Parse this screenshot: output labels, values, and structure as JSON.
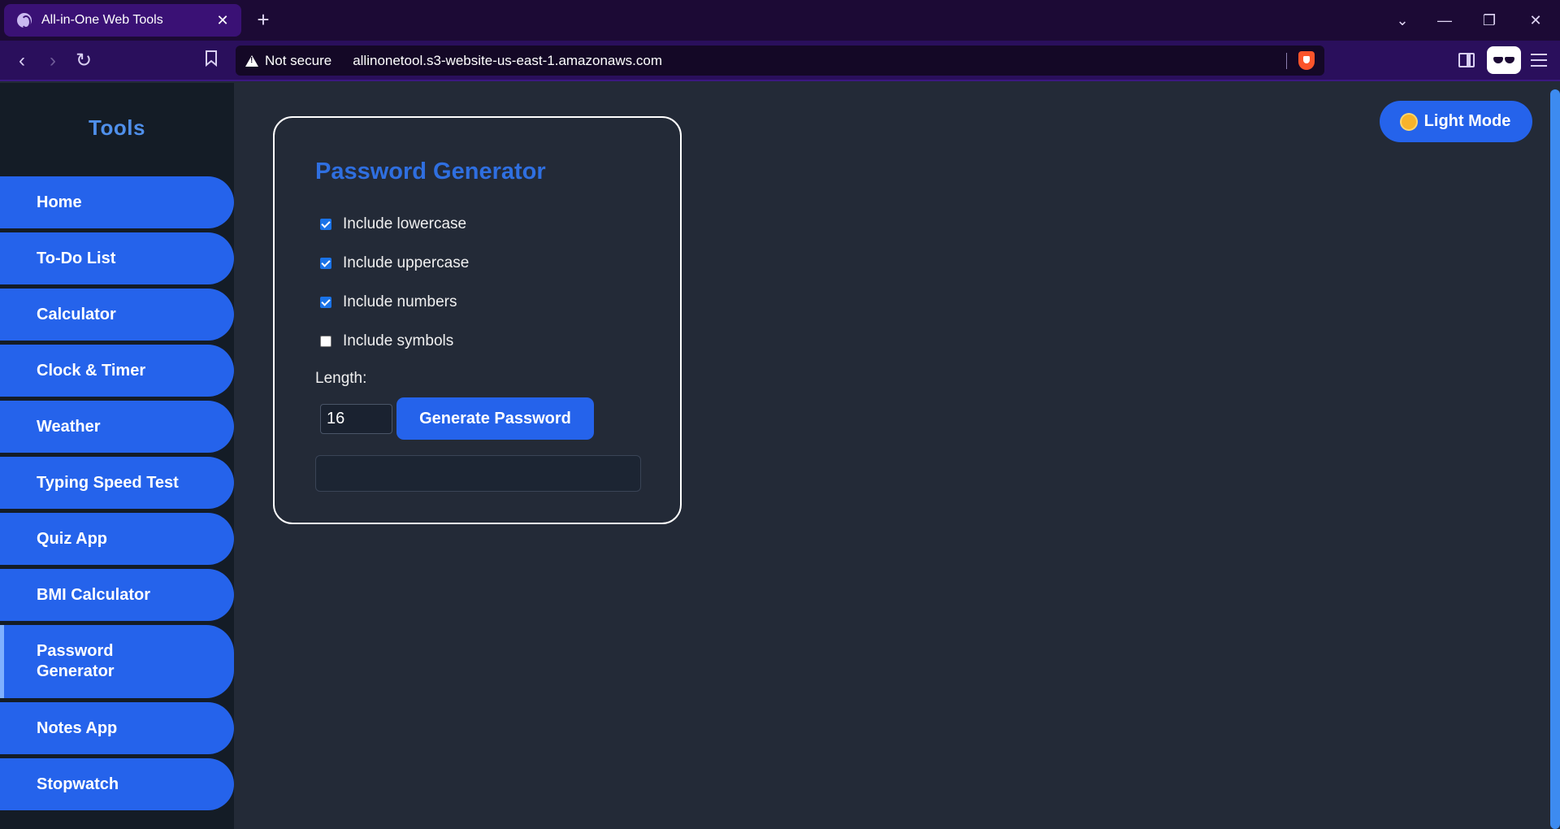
{
  "browser": {
    "tab_title": "All-in-One Web Tools",
    "tab_close": "✕",
    "new_tab": "+",
    "security_label": "Not secure",
    "url": "allinonetool.s3-website-us-east-1.amazonaws.com",
    "window_controls": {
      "dropdown": "⌄",
      "minimize": "—",
      "restore": "❐",
      "close": "✕"
    },
    "nav": {
      "back": "‹",
      "forward": "›",
      "reload": "↻"
    }
  },
  "sidebar": {
    "title": "Tools",
    "items": [
      {
        "label": "Home"
      },
      {
        "label": "To-Do List"
      },
      {
        "label": "Calculator"
      },
      {
        "label": "Clock & Timer"
      },
      {
        "label": "Weather"
      },
      {
        "label": "Typing Speed Test"
      },
      {
        "label": "Quiz App"
      },
      {
        "label": "BMI Calculator"
      },
      {
        "label": "Password Generator",
        "active": true
      },
      {
        "label": "Notes App"
      },
      {
        "label": "Stopwatch"
      }
    ]
  },
  "theme_toggle": {
    "label": "Light Mode",
    "icon": "sun-icon"
  },
  "generator": {
    "title": "Password Generator",
    "options": [
      {
        "label": "Include lowercase",
        "checked": true
      },
      {
        "label": "Include uppercase",
        "checked": true
      },
      {
        "label": "Include numbers",
        "checked": true
      },
      {
        "label": "Include symbols",
        "checked": false
      }
    ],
    "length_label": "Length:",
    "length_value": "16",
    "generate_label": "Generate Password",
    "output_value": ""
  },
  "colors": {
    "accent": "#2563eb",
    "sidebar_bg": "#141c26",
    "page_bg": "#232a37",
    "browser_chrome": "#2a0f5c"
  }
}
